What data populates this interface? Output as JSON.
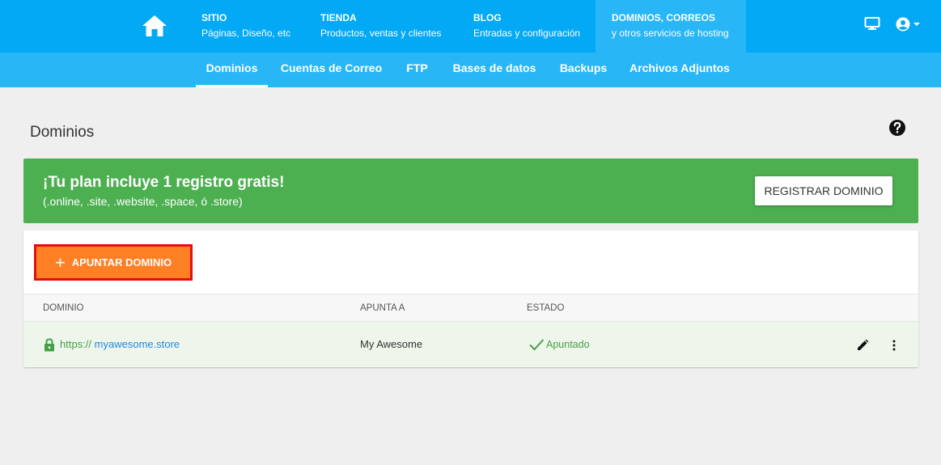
{
  "topnav": {
    "items": [
      {
        "title": "SITIO",
        "subtitle": "Páginas, Diseño, etc"
      },
      {
        "title": "TIENDA",
        "subtitle": "Productos, ventas y clientes"
      },
      {
        "title": "BLOG",
        "subtitle": "Entradas y configuración"
      },
      {
        "title": "DOMINIOS, CORREOS",
        "subtitle": "y otros servicios de hosting"
      }
    ],
    "icons": {
      "home": "home-icon",
      "preview": "monitor-icon",
      "account": "account-circle-icon"
    }
  },
  "subnav": {
    "tabs": [
      "Dominios",
      "Cuentas de Correo",
      "FTP",
      "Bases de datos",
      "Backups",
      "Archivos Adjuntos"
    ],
    "active": "Dominios"
  },
  "page": {
    "title": "Dominios"
  },
  "promo": {
    "title": "¡Tu plan incluye 1 registro gratis!",
    "subtitle": "(.online, .site, .website, .space, ó .store)",
    "button": "REGISTRAR DOMINIO"
  },
  "table": {
    "add_button": "APUNTAR DOMINIO",
    "headers": [
      "DOMINIO",
      "APUNTA A",
      "ESTADO"
    ],
    "rows": [
      {
        "protocol": "https://",
        "domain": "myawesome.store",
        "points_to": "My Awesome",
        "status": "Apuntado"
      }
    ]
  },
  "colors": {
    "topbar": "#03a9f4",
    "subnav": "#29b6f6",
    "promo": "#4caf50",
    "add_button": "#ff7f24",
    "highlight_border": "#e01010",
    "status_green": "#43a047",
    "link_blue": "#1e88e5"
  }
}
